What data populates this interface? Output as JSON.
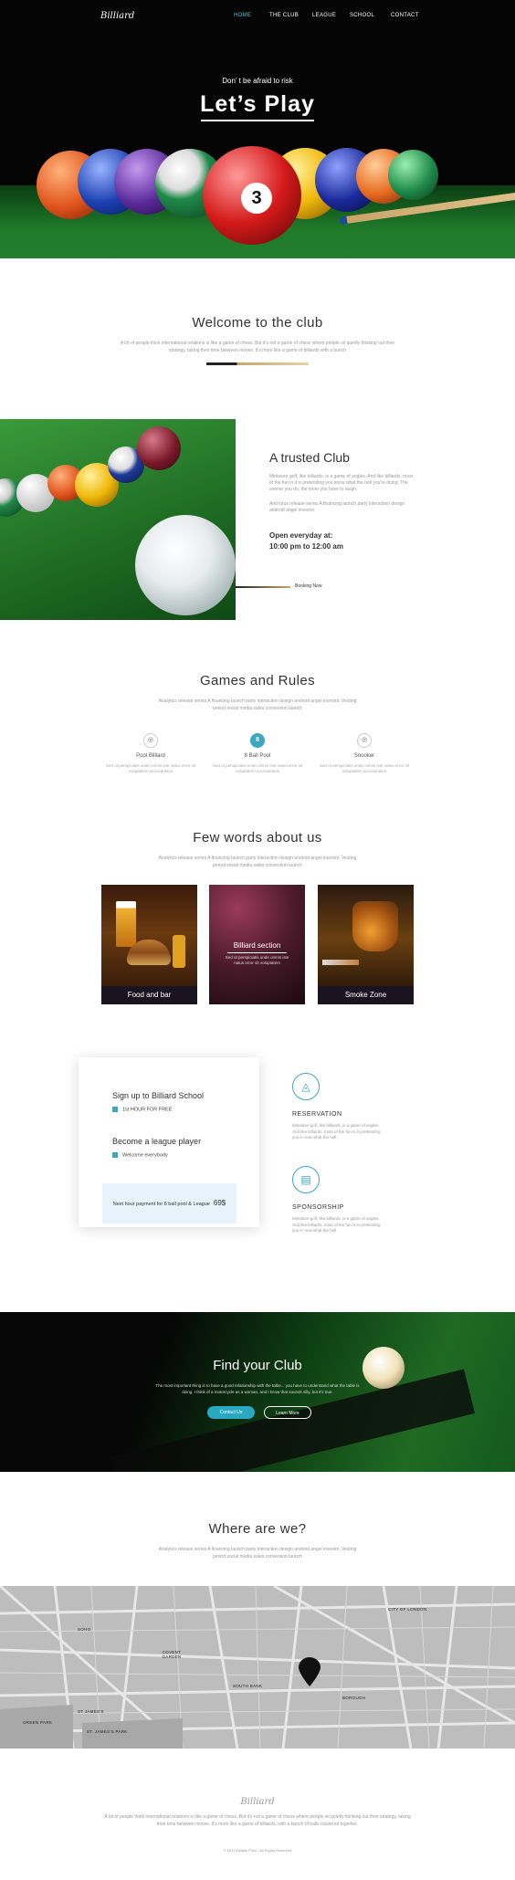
{
  "nav": {
    "logo": "Billiard",
    "items": [
      "HOME",
      "THE CLUB",
      "LEAGUE",
      "SCHOOL",
      "CONTACT"
    ],
    "active": "HOME"
  },
  "hero": {
    "subtitle": "Don’ t be afraid to risk",
    "title": "Let’s Play",
    "ball_number": "3"
  },
  "welcome": {
    "title": "Welcome to the club",
    "text": "A lot of people think international relations is like a game of chess. But it's not a game of chess where people sit quietly thinking out their strategy, taking their time between moves. It's more like a game of billiards with a bunch"
  },
  "trusted": {
    "title": "A trusted Club",
    "text1": "Miniature golf, like billiards, is a game of angles. And like billiards, most of the fun in it is pretending you know what the hell you're doing. The sooner you do, the more you have to laugh.",
    "text2": "And lotus release series A financing launch party interaction design android angel investor.",
    "open_label": "Open everyday at:",
    "open_hours": "10:00 pm to 12:00 am",
    "booking": "Booking Now"
  },
  "games": {
    "title": "Games and Rules",
    "text": "Analytics release series A financing launch party interaction design android angel investor. Vesting period social media sales conversion launch",
    "items": [
      {
        "title": "Pool Billiard",
        "text": "Sed ut perspiciatis unde omnis iste natus error sit voluptatem accusantium"
      },
      {
        "title": "8 Ball Pool",
        "text": "Sed ut perspiciatis unde omnis iste natus error sit voluptatem accusantium",
        "icon_text": "8"
      },
      {
        "title": "Snooker",
        "text": "Sed ut perspiciatis unde omnis iste natus error sit voluptatem accusantium"
      }
    ]
  },
  "about": {
    "title": "Few words about us",
    "text": "Analytics release series A financing launch party interaction design android angel investor. Vesting period social media sales conversion launch",
    "cards": [
      {
        "caption": "Food and bar"
      },
      {
        "title": "Billiard section",
        "text": "Sed ut perspiciatis unde omnis iste natus error sit voluptatem"
      },
      {
        "caption": "Smoke Zone"
      }
    ]
  },
  "signup": {
    "title1": "Sign up to Billiard School",
    "sub1": "1st HOUR FOR FREE",
    "title2": "Become a league player",
    "sub2": "Welcome everybody",
    "price_text": "Next hour payment for 8 ball pool & League",
    "price_value": "69$"
  },
  "services": [
    {
      "title": "RESERVATION",
      "text": "Miniature golf, like billiards, is a game of angles. And like billiards, most of the fun is in pretending you k- now what the hell."
    },
    {
      "title": "SPONSORSHIP",
      "text": "Miniature golf, like billiards, is a game of angles. And like billiards, most of the fun is in pretending you k- now what the hell."
    }
  ],
  "find": {
    "title": "Find your Club",
    "text": "The most important thing is to have a good relationship with the table... you have to understand what the table is doing. I think of a motorcycle as a woman, and I know that sounds silly, but it's true.",
    "btn1": "Contact Us",
    "btn2": "Learn More"
  },
  "location": {
    "title": "Where are we?",
    "text": "Analytics release series A financing launch party interaction design android angel investor. Vesting period social media sales conversion launch",
    "map_labels": [
      "CITY OF LONDON",
      "SOHO",
      "COVENT GARDEN",
      "SOUTH BANK",
      "BOROUGH",
      "GREEN PARK",
      "ST JAMES'S",
      "ST. JAMES'S PARK"
    ]
  },
  "footer": {
    "logo": "Billiard",
    "text": "A lot of people think international relations is like a game of chess. But it's not a game of chess where people sit quietly thinking out their strategy, taking their time between moves. It's more like a game of billiards, with a bunch of balls clustered together.",
    "copyright": "© 2014 Details Pixel - All Rights Reserved"
  }
}
